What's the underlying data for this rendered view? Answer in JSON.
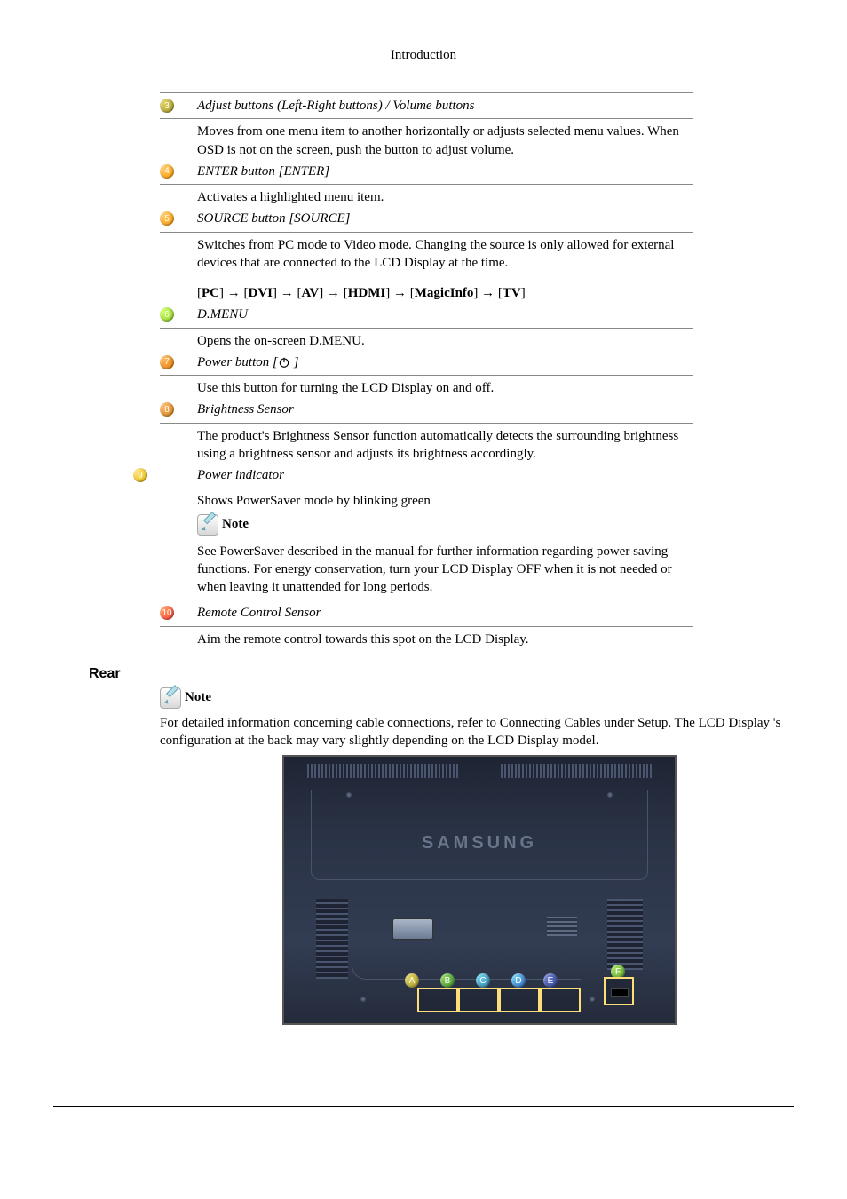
{
  "header": {
    "title": "Introduction"
  },
  "items": [
    {
      "num": "3",
      "badge_class": "c-olive",
      "title": "Adjust buttons (Left-Right buttons) / Volume buttons",
      "body": "Moves from one menu item to another horizontally or adjusts selected menu values. When OSD is not on the screen, push the button to adjust volume."
    },
    {
      "num": "4",
      "badge_class": "c-orange",
      "title": "ENTER button [ENTER]",
      "body": "Activates a highlighted menu item."
    },
    {
      "num": "5",
      "badge_class": "c-orange",
      "title": "SOURCE button [SOURCE]",
      "body": "Switches from PC mode to Video mode. Changing the source is only allowed for external devices that are connected to the LCD Display at the time.",
      "flow_parts": [
        "[",
        "PC",
        "] → [",
        "DVI",
        "] → [",
        "AV",
        "] → [",
        "HDMI",
        "] → [",
        "MagicInfo",
        "] → [",
        "TV",
        "]"
      ]
    },
    {
      "num": "6",
      "badge_class": "c-lime",
      "title": "D.MENU",
      "body": "Opens the on-screen D.MENU."
    },
    {
      "num": "7",
      "badge_class": "c-darkorange",
      "title_pre": "Power button [",
      "title_post": " ]",
      "body": "Use this button for turning the LCD Display on and off."
    },
    {
      "num": "8",
      "badge_class": "c-dorange2",
      "title": "Brightness Sensor",
      "body": "The product's Brightness Sensor function automatically detects the surrounding brightness using a brightness sensor and adjusts its brightness accordingly."
    },
    {
      "num": "9",
      "badge_class": "c-gold",
      "title": "Power indicator",
      "body": "Shows PowerSaver mode by blinking green",
      "note_label": "Note",
      "note_body": "See PowerSaver described in the manual for further information regarding power saving functions. For energy conservation, turn your LCD Display OFF when it is not needed or when leaving it unattended for long periods."
    },
    {
      "num": "10",
      "badge_class": "c-red",
      "title": "Remote Control Sensor",
      "body": "Aim the remote control towards this spot on the LCD Display."
    }
  ],
  "rear_section": {
    "title": "Rear",
    "note_label": "Note",
    "note_body": "For detailed information concerning cable connections, refer to Connecting Cables under Setup. The LCD Display 's configuration at the back may vary slightly depending on the LCD Display model.",
    "brand": "SAMSUNG",
    "letters": {
      "A": "A",
      "B": "B",
      "C": "C",
      "D": "D",
      "E": "E",
      "F": "F"
    }
  }
}
